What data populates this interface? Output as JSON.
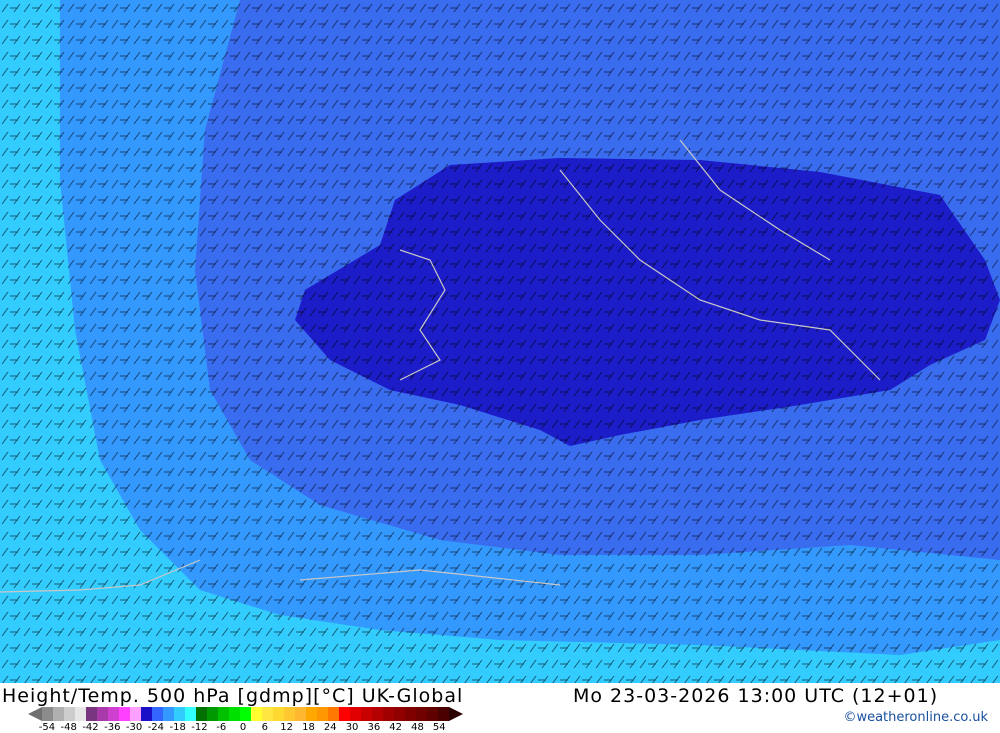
{
  "header": {
    "title": "Height/Temp. 500 hPa [gdmp][°C] UK-Global",
    "datetime": "Mo 23-03-2026 13:00 UTC (12+01)",
    "credit": "©weatheronline.co.uk"
  },
  "legend": {
    "ticks": [
      "-54",
      "-48",
      "-42",
      "-36",
      "-30",
      "-24",
      "-18",
      "-12",
      "-6",
      "0",
      "6",
      "12",
      "18",
      "24",
      "30",
      "36",
      "42",
      "48",
      "54"
    ],
    "colors": [
      "#8c8c8c",
      "#b0b0b0",
      "#cccccc",
      "#e6e6e6",
      "#7a3580",
      "#a83aaa",
      "#d040d0",
      "#ff40ff",
      "#ffa0ff",
      "#1a10c8",
      "#3366ff",
      "#3399ff",
      "#33ccff",
      "#33ffff",
      "#007000",
      "#009a00",
      "#00c000",
      "#00e000",
      "#00ff00",
      "#ffff30",
      "#ffe640",
      "#ffd830",
      "#ffc830",
      "#ffb830",
      "#ffa800",
      "#ff9800",
      "#ff7800",
      "#ff0000",
      "#e00000",
      "#c80000",
      "#b40000",
      "#a00000",
      "#900000",
      "#800000",
      "#700000",
      "#600000",
      "#4a0000"
    ]
  },
  "map_colors": {
    "outer": "#33ccff",
    "band1": "#3399ff",
    "band2": "#3a6cf0",
    "core": "#1c1cc8",
    "coast": "#c8c8c8"
  }
}
